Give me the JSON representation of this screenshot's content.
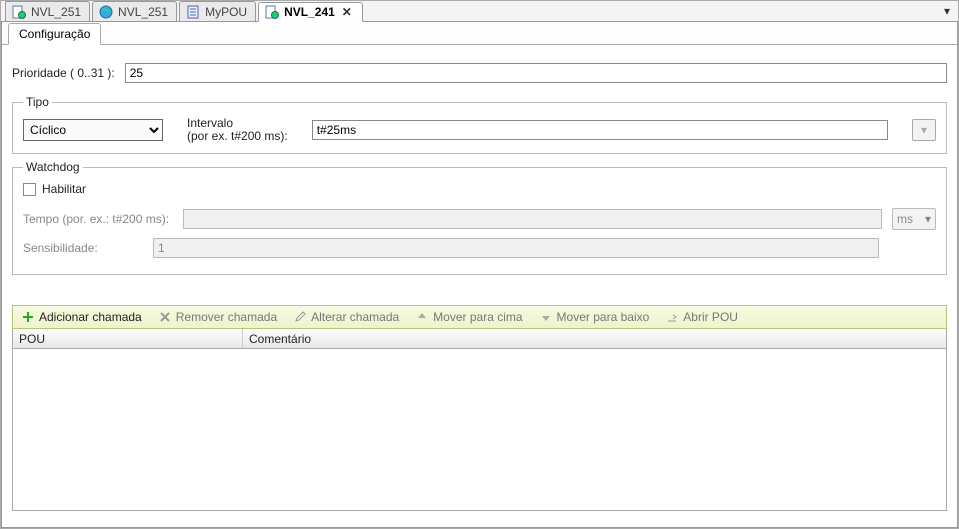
{
  "tabs": {
    "items": [
      {
        "label": "NVL_251",
        "icon": "doc-globe"
      },
      {
        "label": "NVL_251",
        "icon": "world"
      },
      {
        "label": "MyPOU",
        "icon": "struct"
      },
      {
        "label": "NVL_241",
        "icon": "doc-globe",
        "active": true,
        "closable": true
      }
    ]
  },
  "subtab": {
    "label": "Configuração"
  },
  "form": {
    "priority_label": "Prioridade ( 0..31 ):",
    "priority_value": "25",
    "tipo_legend": "Tipo",
    "tipo_select_value": "Cíclico",
    "intervalo_label_1": "Intervalo",
    "intervalo_label_2": "(por ex. t#200 ms):",
    "intervalo_value": "t#25ms",
    "watchdog_legend": "Watchdog",
    "watchdog_enable_label": "Habilitar",
    "watchdog_enable_checked": false,
    "watchdog_time_label": "Tempo (por. ex.: t#200 ms):",
    "watchdog_time_value": "",
    "watchdog_time_unit": "ms",
    "watchdog_sens_label": "Sensibilidade:",
    "watchdog_sens_value": "1"
  },
  "toolbar": {
    "add_label": "Adicionar chamada",
    "remove_label": "Remover chamada",
    "change_label": "Alterar chamada",
    "moveup_label": "Mover para cima",
    "movedown_label": "Mover para baixo",
    "openpou_label": "Abrir POU"
  },
  "table": {
    "columns": [
      "POU",
      "Comentário"
    ]
  }
}
